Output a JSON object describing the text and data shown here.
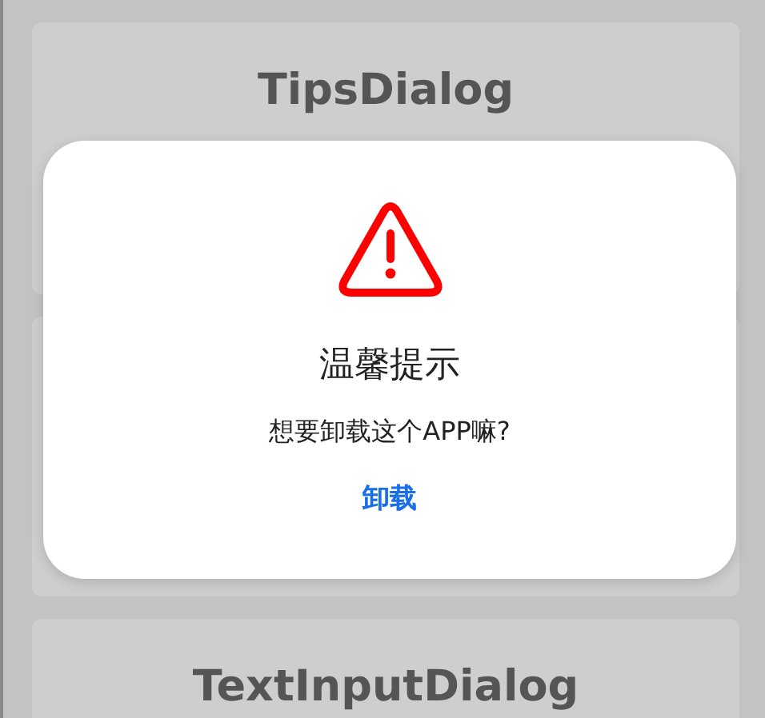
{
  "cards": [
    {
      "title": "TipsDialog"
    },
    {
      "title": "TextInputDialog"
    }
  ],
  "dialog": {
    "title": "温馨提示",
    "message": "想要卸载这个APP嘛?",
    "buttons": [
      "卸载"
    ]
  }
}
